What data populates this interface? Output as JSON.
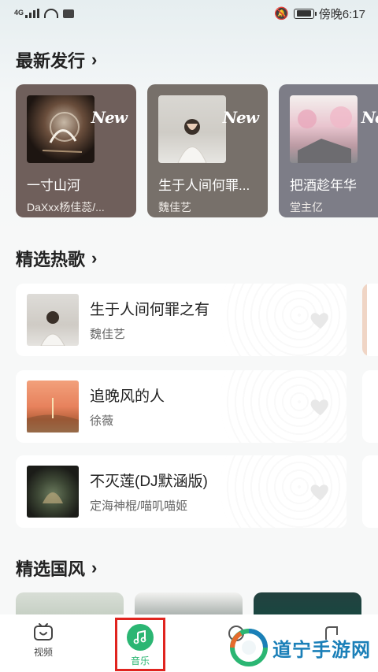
{
  "status_bar": {
    "network": "4G",
    "time_text": "傍晚6:17",
    "icons": [
      "signal-icon",
      "wifi-icon",
      "app-notification-icon",
      "mute-bell-icon",
      "battery-icon"
    ]
  },
  "new_releases": {
    "heading": "最新发行",
    "badge": "New",
    "items": [
      {
        "title": "一寸山河",
        "artist": "DaXxx杨佳蕊/..."
      },
      {
        "title": "生于人间何罪...",
        "artist": "魏佳艺"
      },
      {
        "title": "把酒趁年华",
        "artist": "堂主亿"
      }
    ]
  },
  "hot_songs": {
    "heading": "精选热歌",
    "items": [
      {
        "title": "生于人间何罪之有",
        "artist": "魏佳艺"
      },
      {
        "title": "追晚风的人",
        "artist": "徐薇"
      },
      {
        "title": "不灭莲(DJ默涵版)",
        "artist": "定海神棍/喵叽喵姬"
      }
    ]
  },
  "guofeng": {
    "heading": "精选国风"
  },
  "bottom_nav": {
    "video_label": "视频",
    "music_label": "音乐",
    "active": "音乐"
  },
  "watermark": {
    "text": "道宁手游网"
  },
  "colors": {
    "accent_green": "#2bb673",
    "highlight_red": "#e0241f"
  }
}
